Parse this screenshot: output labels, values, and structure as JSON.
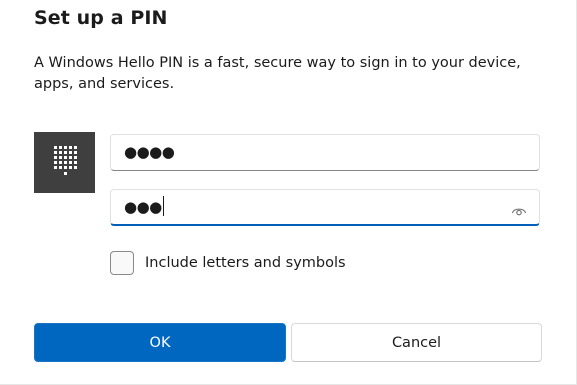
{
  "dialog": {
    "title": "Set up a PIN",
    "description": "A Windows Hello PIN is a fast, secure way to sign in to your device, apps, and services."
  },
  "pin_field": {
    "masked_value": "●●●●"
  },
  "confirm_pin_field": {
    "masked_value": "●●●",
    "reveal_icon": "eye-icon",
    "focused": true
  },
  "options": {
    "include_letters_label": "Include letters and symbols",
    "include_letters_checked": false
  },
  "buttons": {
    "ok_label": "OK",
    "cancel_label": "Cancel"
  },
  "icons": {
    "tile": "keypad-icon"
  },
  "colors": {
    "accent": "#0067c0",
    "focus_underline": "#005fb8",
    "tile_background": "#3f3f3f"
  }
}
